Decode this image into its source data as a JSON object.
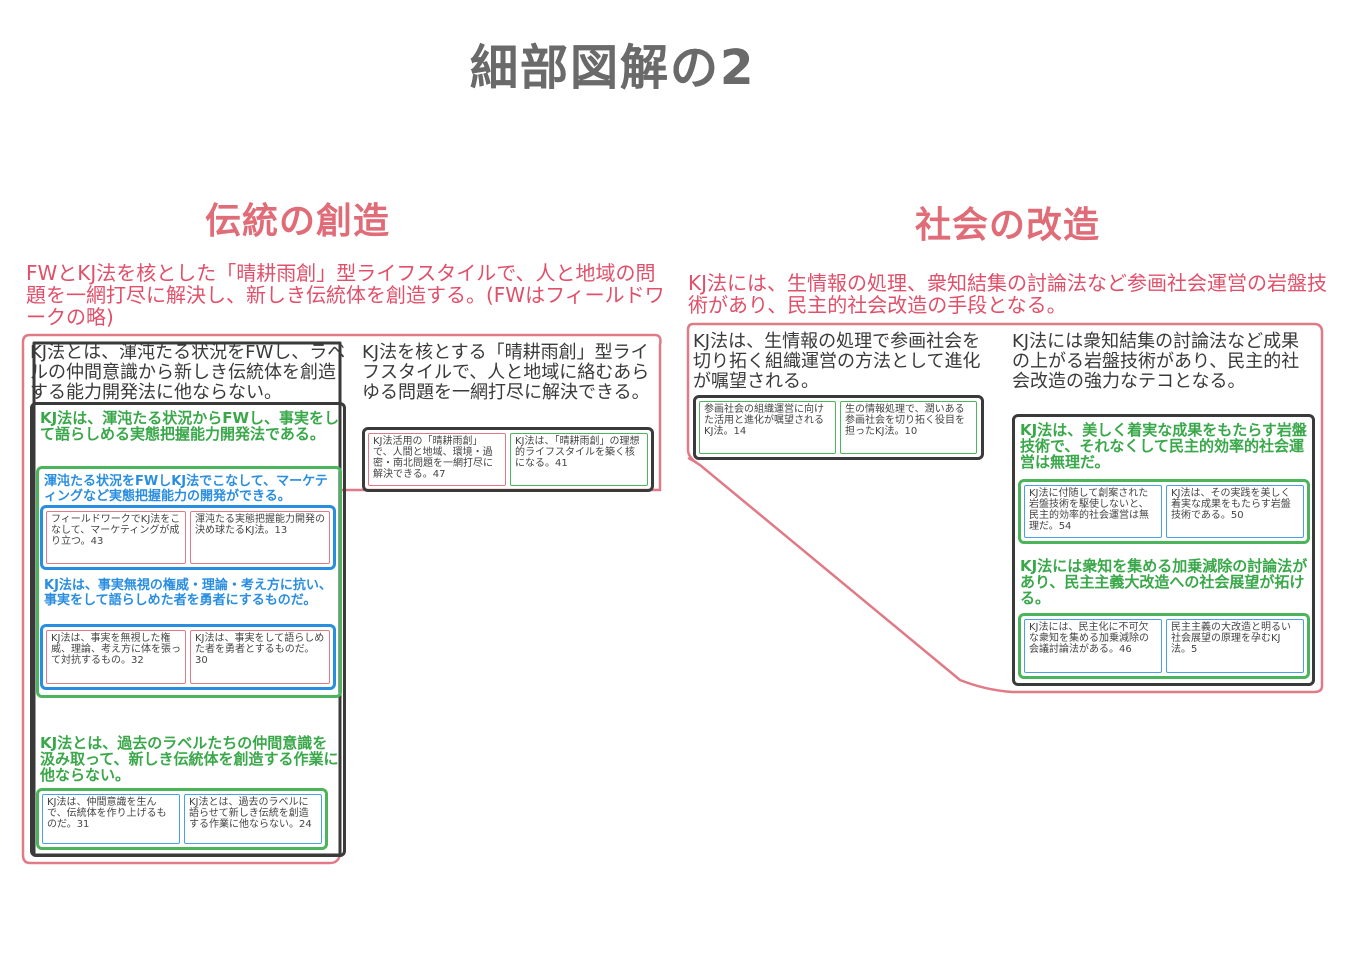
{
  "title": "細部図解の2",
  "left": {
    "heading": "伝統の創造",
    "intro": "FWとKJ法を核とした「晴耕雨創」型ライフスタイルで、人と地域の問題を一網打尽に解決し、新しき伝統体を創造する。(FWはフィールドワークの略)",
    "col1_text": "KJ法とは、渾沌たる状況をFWし、ラベルの仲間意識から新しき伝統体を創造する能力開発法に他ならない。",
    "g1_text": "KJ法は、渾沌たる状況からFWし、事実をして語らしめる実態把握能力開発法である。",
    "b1_text": "渾沌たる状況をFWしKJ法でこなして、マーケティングなど実態把握能力の開発ができる。",
    "b1_cards": [
      "フィールドワークでKJ法をこなして、マーケティングが成り立つ。43",
      "渾沌たる実態把握能力開発の決め球たるKJ法。13"
    ],
    "b2_text": "KJ法は、事実無視の権威・理論・考え方に抗い、事実をして語らしめた者を勇者にするものだ。",
    "b2_cards": [
      "KJ法は、事実を無視した権威、理論、考え方に体を張って対抗するもの。32",
      "KJ法は、事実をして語らしめた者を勇者とするものだ。30"
    ],
    "g2_text": "KJ法とは、過去のラベルたちの仲間意識を汲み取って、新しき伝統体を創造する作業に他ならない。",
    "g2_cards": [
      "KJ法は、仲間意識を生んで、伝統体を作り上げるものだ。31",
      "KJ法とは、過去のラベルに語らせて新しき伝統を創造する作業に他ならない。24"
    ],
    "col2_text": "KJ法を核とする「晴耕雨創」型ライフスタイルで、人と地域に絡むあらゆる問題を一網打尽に解決できる。",
    "col2_cards": [
      "KJ法活用の「晴耕雨創」で、人間と地域、環境・過密・南北問題を一網打尽に解決できる。47",
      "KJ法は、「晴耕雨創」の理想的ライフスタイルを築く核になる。41"
    ]
  },
  "right": {
    "heading": "社会の改造",
    "intro": "KJ法には、生情報の処理、衆知結集の討論法など参画社会運営の岩盤技術があり、民主的社会改造の手段となる。",
    "col1_text": "KJ法は、生情報の処理で参画社会を切り拓く組織運営の方法として進化が嘱望される。",
    "col1_cards": [
      "参画社会の組織運営に向けた活用と進化が嘱望されるKJ法。14",
      "生の情報処理で、潤いある参画社会を切り拓く役目を担ったKJ法。10"
    ],
    "col2_text": "KJ法には衆知結集の討論法など成果の上がる岩盤技術があり、民主的社会改造の強力なテコとなる。",
    "g1_text": "KJ法は、美しく着実な成果をもたらす岩盤技術で、それなくして民主的効率的社会運営は無理だ。",
    "g1_cards": [
      "KJ法に付随して創案された岩盤技術を駆使しないと、民主的効率的社会運営は無理だ。54",
      "KJ法は、その実践を美しく着実な成果をもたらす岩盤技術である。50"
    ],
    "g2_text": "KJ法には衆知を集める加乗減除の討論法があり、民主主義大改造への社会展望が拓ける。",
    "g2_cards": [
      "KJ法には、民主化に不可欠な衆知を集める加乗減除の会議討論法がある。46",
      "民主主義の大改造と明るい社会展望の原理を孕むKJ法。5"
    ]
  },
  "colors": {
    "red": "#e0506a",
    "dark": "#3a3a3a",
    "green": "#4cb45a",
    "blue": "#2a8ee0"
  }
}
